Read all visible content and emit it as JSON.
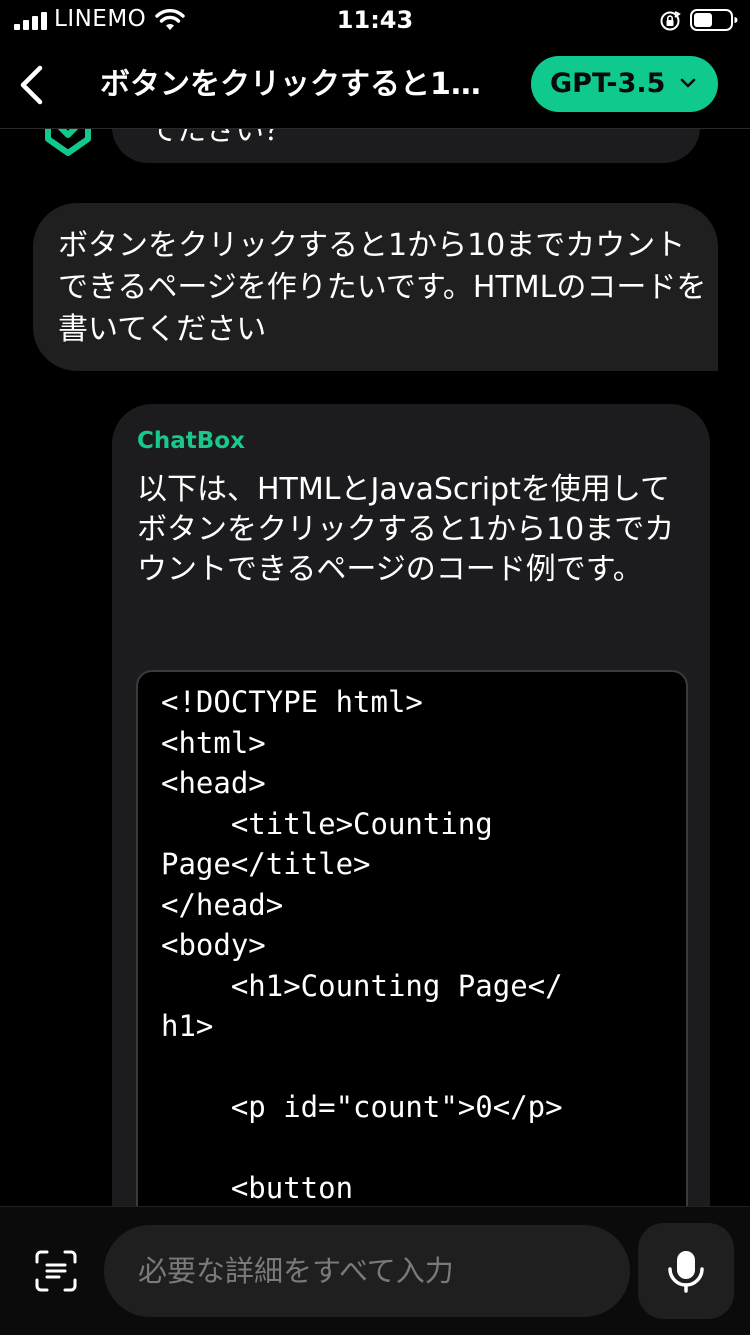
{
  "status_bar": {
    "carrier": "LINEMO",
    "time": "11:43"
  },
  "header": {
    "title": "ボタンをクリックすると1…",
    "model_label": "GPT-3.5"
  },
  "messages": {
    "previous_partial": "てたさい？",
    "user": "ボタンをクリックすると1から10までカウントできるページを作りたいです。HTMLのコードを書いてください",
    "bot_name": "ChatBox",
    "bot_text": "以下は、HTMLとJavaScriptを使用してボタンをクリックすると1から10までカウントできるページのコード例です。",
    "code": "<!DOCTYPE html>\n<html>\n<head>\n    <title>Counting\nPage</title>\n</head>\n<body>\n    <h1>Counting Page</\nh1>\n\n    <p id=\"count\">0</p>\n\n    <button"
  },
  "input": {
    "placeholder": "必要な詳細をすべて入力"
  },
  "colors": {
    "accent": "#10c98f",
    "bot_name": "#18c98e",
    "bubble": "#1f1f1f",
    "background": "#000000"
  },
  "icons": {
    "back": "chevron-left-icon",
    "model_dropdown": "chevron-down-icon",
    "scan": "scan-text-icon",
    "mic": "microphone-icon",
    "avatar": "chatbox-logo-icon"
  }
}
